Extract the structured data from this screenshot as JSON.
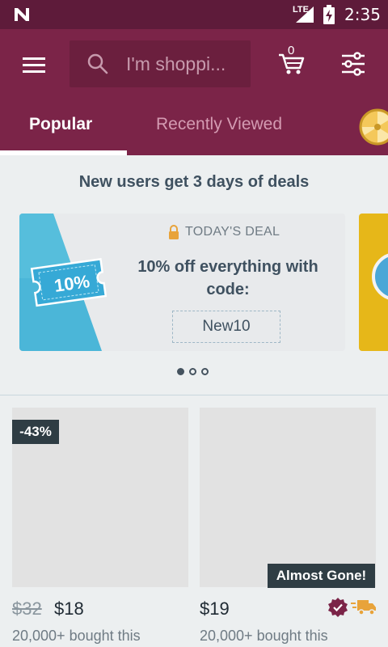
{
  "status_bar": {
    "network": "LTE",
    "time": "2:35"
  },
  "toolbar": {
    "search_placeholder": "I'm shoppi...",
    "cart_count": "0"
  },
  "tabs": [
    {
      "label": "Popular",
      "selected": true
    },
    {
      "label": "Recently Viewed",
      "selected": false
    }
  ],
  "promo": {
    "header": "New users get 3 days of deals",
    "deal": {
      "ticket_text": "10%",
      "label": "TODAY'S DEAL",
      "text": "10% off everything with code:",
      "code": "New10"
    },
    "pager": {
      "count": 3,
      "active": 0
    }
  },
  "products": [
    {
      "badge": "-43%",
      "old_price": "$32",
      "price": "$18",
      "bought": "20,000+ bought this"
    },
    {
      "badge": "Almost Gone!",
      "price": "$19",
      "bought": "20,000+ bought this"
    }
  ],
  "colors": {
    "brand": "#7b2448",
    "status_bar": "#5e1b3a",
    "badge": "#2f3d44",
    "deal_blue": "#4bb6d8",
    "accent_orange": "#e8a33a"
  }
}
